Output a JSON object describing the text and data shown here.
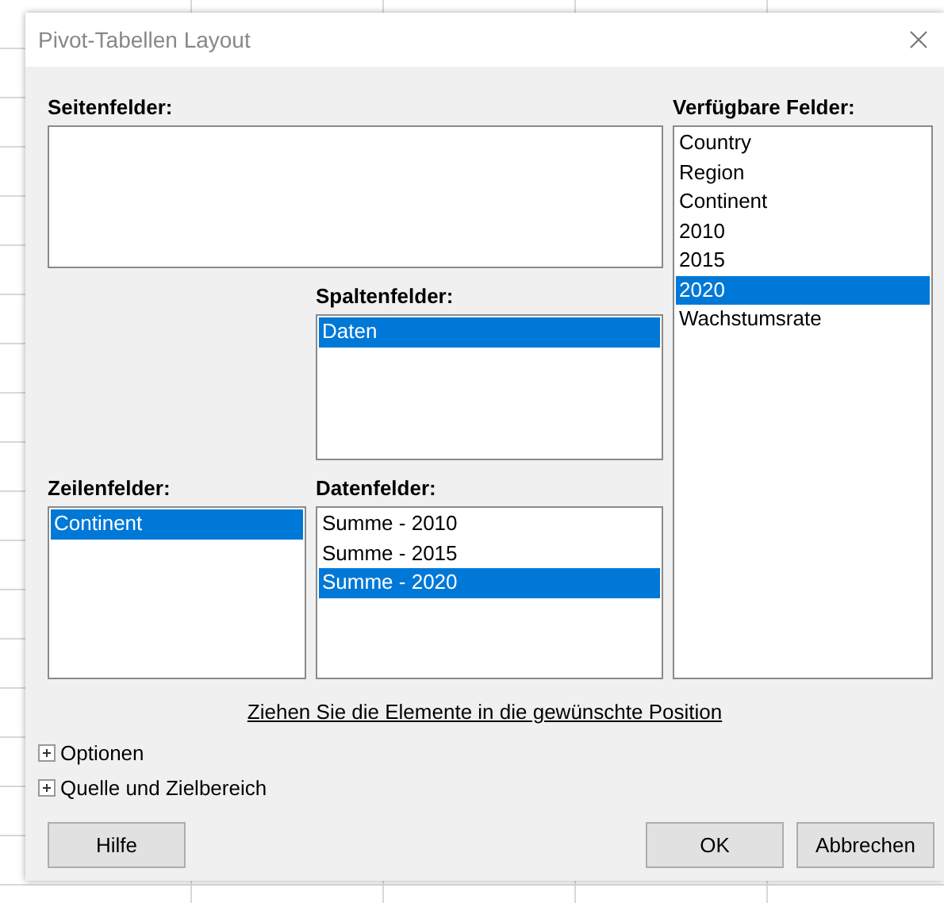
{
  "window": {
    "title": "Pivot-Tabellen Layout"
  },
  "page_fields": {
    "label": "Seitenfelder:"
  },
  "column_fields": {
    "label": "Spaltenfelder:",
    "items": [
      {
        "text": "Daten",
        "selected": true
      }
    ]
  },
  "row_fields": {
    "label": "Zeilenfelder:",
    "items": [
      {
        "text": "Continent",
        "selected": true
      }
    ]
  },
  "data_fields": {
    "label": "Datenfelder:",
    "items": [
      {
        "text": "Summe - 2010",
        "selected": false
      },
      {
        "text": "Summe - 2015",
        "selected": false
      },
      {
        "text": "Summe - 2020",
        "selected": true
      }
    ]
  },
  "available_fields": {
    "label": "Verfügbare Felder:",
    "items": [
      {
        "text": "Country",
        "selected": false
      },
      {
        "text": "Region",
        "selected": false
      },
      {
        "text": "Continent",
        "selected": false
      },
      {
        "text": "2010",
        "selected": false
      },
      {
        "text": "2015",
        "selected": false
      },
      {
        "text": "2020",
        "selected": true
      },
      {
        "text": "Wachstumsrate",
        "selected": false
      }
    ]
  },
  "hint": "Ziehen Sie die Elemente in die gewünschte Position",
  "expanders": [
    {
      "label": "Optionen",
      "expanded": false
    },
    {
      "label": "Quelle und Zielbereich",
      "expanded": false
    }
  ],
  "buttons": {
    "left": [
      "Hilfe"
    ],
    "right": [
      "OK",
      "Abbrechen"
    ]
  }
}
